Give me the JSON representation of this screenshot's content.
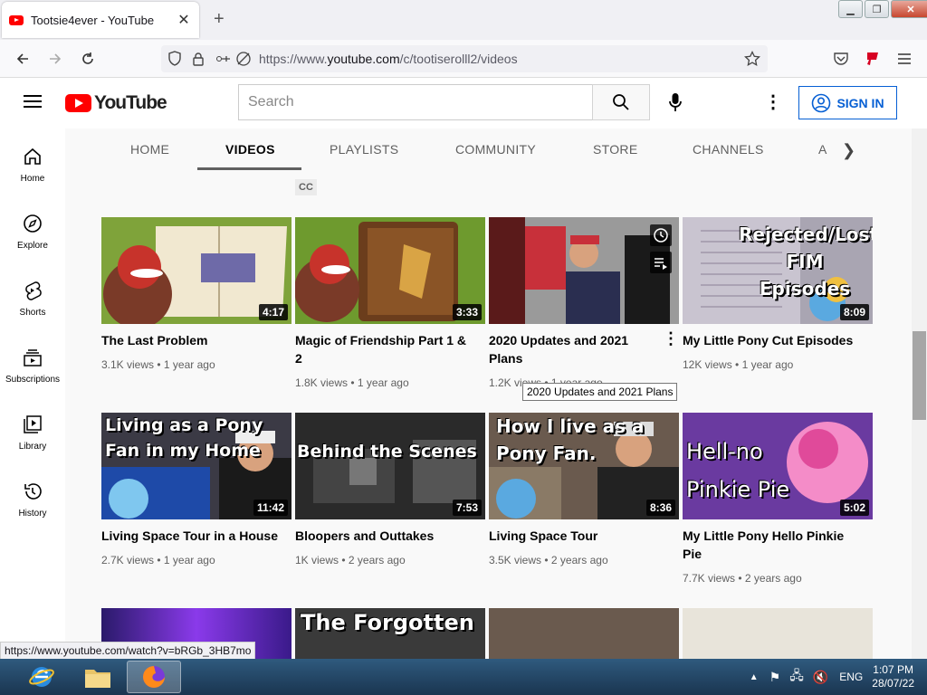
{
  "browser": {
    "tab_title": "Tootsie4ever - YouTube",
    "url_prefix": "https://www.",
    "url_domain": "youtube.com",
    "url_path": "/c/tootiserolll2/videos",
    "status_url": "https://www.youtube.com/watch?v=bRGb_3HB7mo"
  },
  "header": {
    "logo_text": "YouTube",
    "search_placeholder": "Search",
    "sign_in": "SIGN IN"
  },
  "sidebar": {
    "items": [
      {
        "label": "Home",
        "icon": "home-icon"
      },
      {
        "label": "Explore",
        "icon": "compass-icon"
      },
      {
        "label": "Shorts",
        "icon": "shorts-icon"
      },
      {
        "label": "Subscriptions",
        "icon": "subscriptions-icon"
      },
      {
        "label": "Library",
        "icon": "library-icon"
      },
      {
        "label": "History",
        "icon": "history-icon"
      }
    ]
  },
  "channel_tabs": [
    "HOME",
    "VIDEOS",
    "PLAYLISTS",
    "COMMUNITY",
    "STORE",
    "CHANNELS",
    "A"
  ],
  "cc_badge": "CC",
  "videos": [
    {
      "title": "The Last Problem",
      "views": "3.1K views",
      "age": "1 year ago",
      "duration": "4:17"
    },
    {
      "title": "Magic of Friendship Part 1 & 2",
      "views": "1.8K views",
      "age": "1 year ago",
      "duration": "3:33"
    },
    {
      "title": "2020 Updates and 2021 Plans",
      "views": "1.2K views",
      "age": "1 year ago",
      "duration": ""
    },
    {
      "title": "My Little Pony Cut Episodes",
      "views": "12K views",
      "age": "1 year ago",
      "duration": "8:09",
      "thumb_text": "Rejected/Lost FIM Episodes"
    },
    {
      "title": "Living Space Tour in a House",
      "views": "2.7K views",
      "age": "1 year ago",
      "duration": "11:42",
      "thumb_text": "Living as a Pony Fan in my Home"
    },
    {
      "title": "Bloopers and Outtakes",
      "views": "1K views",
      "age": "2 years ago",
      "duration": "7:53",
      "thumb_text": "Behind the Scenes of Recording a Vi"
    },
    {
      "title": "Living Space Tour",
      "views": "3.5K views",
      "age": "2 years ago",
      "duration": "8:36",
      "thumb_text": "How I live as a Pony Fan."
    },
    {
      "title": "My Little Pony Hello Pinkie Pie",
      "views": "7.7K views",
      "age": "2 years ago",
      "duration": "5:02",
      "thumb_text": "Hell-no Pinkie Pie"
    }
  ],
  "row3_thumb_text": "The Forgotten",
  "tooltip": "2020 Updates and 2021 Plans",
  "taskbar": {
    "language": "ENG",
    "time": "1:07 PM",
    "date": "28/07/22"
  }
}
